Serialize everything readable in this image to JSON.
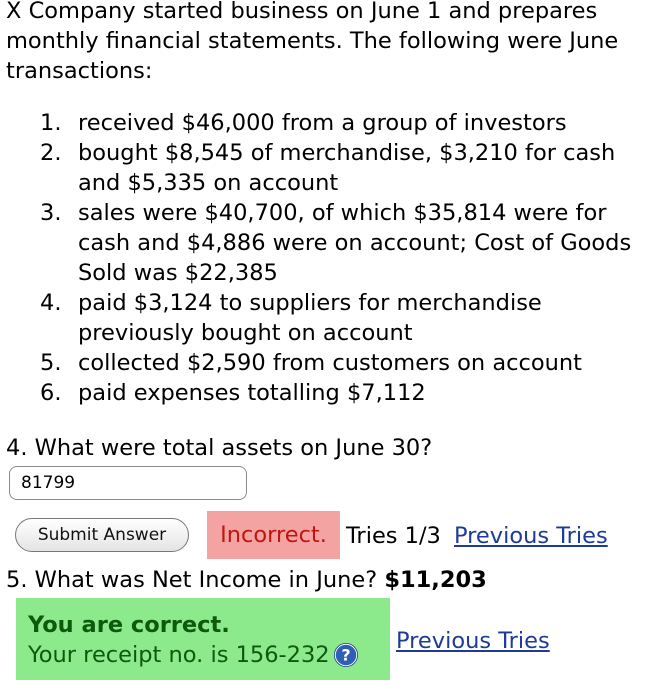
{
  "intro": "X Company started business on June 1 and prepares monthly financial statements. The following were June transactions:",
  "transactions": [
    {
      "num": "1.",
      "text": "received $46,000 from a group of investors"
    },
    {
      "num": "2.",
      "text": "bought $8,545 of merchandise, $3,210 for cash and $5,335 on account"
    },
    {
      "num": "3.",
      "text": "sales were $40,700, of which $35,814 were for cash and $4,886 were on account; Cost of Goods Sold was $22,385"
    },
    {
      "num": "4.",
      "text": "paid $3,124 to suppliers for merchandise previously bought on account"
    },
    {
      "num": "5.",
      "text": "collected $2,590 from customers on account"
    },
    {
      "num": "6.",
      "text": "paid expenses totalling $7,112"
    }
  ],
  "question4": {
    "prompt": "4. What were total assets on June 30?",
    "answer_value": "81799",
    "submit_label": "Submit Answer",
    "status": "Incorrect.",
    "tries": "Tries 1/3",
    "previous_tries_link": "Previous Tries"
  },
  "question5": {
    "prompt": "5. What was Net Income in June?",
    "answer": "$11,203",
    "correct_title": "You are correct.",
    "receipt": "Your receipt no. is 156-232",
    "help_icon": "question-mark-icon",
    "previous_tries_link": "Previous Tries"
  },
  "colors": {
    "incorrect_bg": "#f4a3a3",
    "incorrect_text": "#c0140f",
    "correct_bg": "#8ce98c",
    "correct_text": "#0d5a0d",
    "link": "#1d3b97",
    "help_icon": "#2f5fb5"
  }
}
